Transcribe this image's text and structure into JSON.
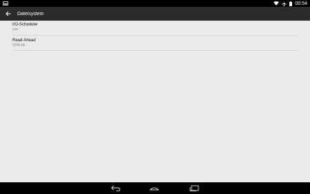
{
  "status_bar": {
    "time": "00:54",
    "left_icon": "screenshot-icon",
    "right_icons": [
      "wifi-icon",
      "airplane-icon",
      "battery-icon"
    ]
  },
  "action_bar": {
    "title": "Dateisystem",
    "back_icon": "back-arrow-icon"
  },
  "preferences": [
    {
      "title": "I/O-Scheduler",
      "summary": "row"
    },
    {
      "title": "Read-Ahead",
      "summary": "2048 kB"
    }
  ],
  "nav_bar": {
    "buttons": [
      "back-nav-icon",
      "home-nav-icon",
      "recents-nav-icon"
    ]
  },
  "colors": {
    "background": "#eaeaea",
    "action_bar": "#2b2b2b",
    "status_bar": "#000000",
    "divider": "#d4d4d4"
  }
}
